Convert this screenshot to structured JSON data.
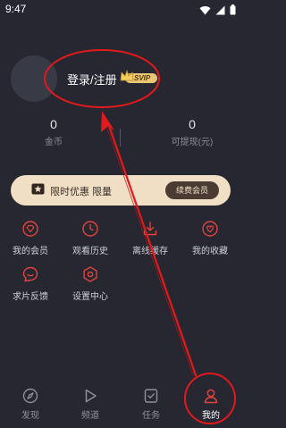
{
  "status_bar": {
    "time": "9:47"
  },
  "profile": {
    "login_text": "登录/注册",
    "badge_text": "SVIP"
  },
  "stats": [
    {
      "value": "0",
      "label": "金币"
    },
    {
      "value": "0",
      "label": "可提现(元)"
    }
  ],
  "vip_banner": {
    "text": "限时优惠 限量",
    "button_label": "续费会员"
  },
  "features": [
    {
      "label": "我的会员",
      "icon": "diamond-icon"
    },
    {
      "label": "观看历史",
      "icon": "clock-icon"
    },
    {
      "label": "离线缓存",
      "icon": "download-icon"
    },
    {
      "label": "我的收藏",
      "icon": "heart-icon"
    },
    {
      "label": "求片反馈",
      "icon": "feedback-icon"
    },
    {
      "label": "设置中心",
      "icon": "gear-icon"
    }
  ],
  "tabs": [
    {
      "label": "发现",
      "icon": "compass-icon",
      "active": false
    },
    {
      "label": "频道",
      "icon": "play-icon",
      "active": false
    },
    {
      "label": "任务",
      "icon": "task-icon",
      "active": false
    },
    {
      "label": "我的",
      "icon": "user-icon",
      "active": true
    }
  ],
  "colors": {
    "background": "#262731",
    "accent_red": "#e0433d",
    "vip_gold": "#e9c673",
    "banner": "#f1dfc5",
    "annotation": "#e3191b"
  }
}
